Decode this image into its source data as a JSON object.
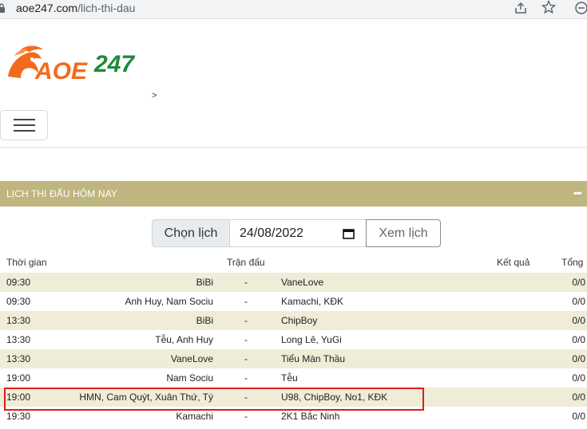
{
  "browser": {
    "url_domain": "aoe247.com",
    "url_path": "/lich-thi-dau"
  },
  "breadcrumb": {
    "separator": ">"
  },
  "logo": {
    "text_a": "AOE",
    "text_b": "247"
  },
  "section": {
    "title": "LỊCH THI ĐẤU HÔM NAY",
    "more": "•••"
  },
  "date_picker": {
    "addon_label": "Chọn lịch",
    "value": "24/08/2022",
    "button_label": "Xem lịch"
  },
  "table": {
    "headers": {
      "time": "Thời gian",
      "match": "Trận đấu",
      "result": "Kết quả",
      "total": "Tổng"
    },
    "rows": [
      {
        "time": "09:30",
        "home": "BiBi",
        "dash": "-",
        "away": "VaneLove",
        "total": "0/0"
      },
      {
        "time": "09:30",
        "home": "Anh Huy, Nam Sociu",
        "dash": "-",
        "away": "Kamachi, KĐK",
        "total": "0/0"
      },
      {
        "time": "13:30",
        "home": "BiBi",
        "dash": "-",
        "away": "ChipBoy",
        "total": "0/0"
      },
      {
        "time": "13:30",
        "home": "Tễu, Anh Huy",
        "dash": "-",
        "away": "Long Lê, YuGi",
        "total": "0/0"
      },
      {
        "time": "13:30",
        "home": "VaneLove",
        "dash": "-",
        "away": "Tiểu Màn Thầu",
        "total": "0/0"
      },
      {
        "time": "19:00",
        "home": "Nam Sociu",
        "dash": "-",
        "away": "Tễu",
        "total": "0/0"
      },
      {
        "time": "19:00",
        "home": "HMN, Cam Quýt, Xuân Thứ, Tý",
        "dash": "-",
        "away": "U98, ChipBoy, No1, KĐK",
        "total": "0/0"
      },
      {
        "time": "19:30",
        "home": "Kamachi",
        "dash": "-",
        "away": "2K1 Bắc Ninh",
        "total": "0/0"
      }
    ]
  },
  "colors": {
    "section_header": "#bfb57f",
    "row_stripe": "#efedd7",
    "highlight": "#e01b1b",
    "logo_orange": "#f26b1d",
    "logo_green": "#1e8a3a"
  }
}
